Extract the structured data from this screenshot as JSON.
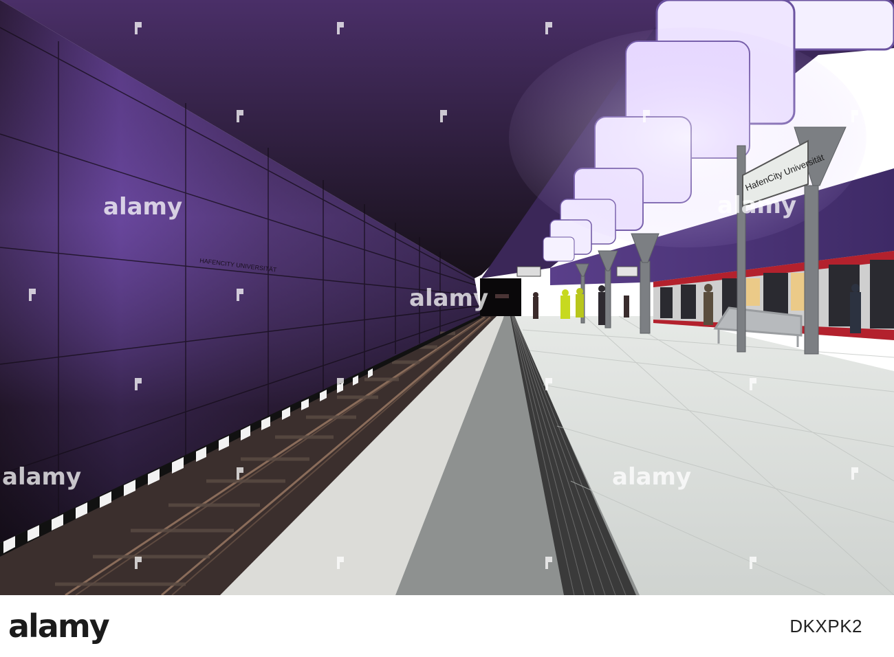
{
  "scene": {
    "station_sign": "HafenCity Universität",
    "wall_lettering": "HAFENCITY UNIVERSITÄT"
  },
  "watermark": {
    "brand": "alamy"
  },
  "footer": {
    "brand": "alamy",
    "stock_id": "DKXPK2"
  },
  "colors": {
    "wall_purple": "#6b4aa0",
    "light_panel": "#efe8ff",
    "platform_floor": "#d8dad8",
    "track_bed": "#3b2f2d",
    "train_red": "#b3212d"
  }
}
